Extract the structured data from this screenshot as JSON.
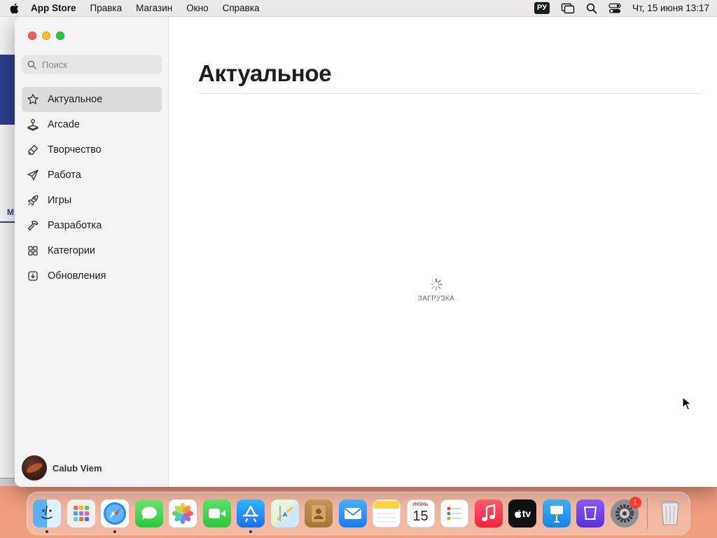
{
  "menubar": {
    "app_name": "App Store",
    "menus": [
      "Правка",
      "Магазин",
      "Окно",
      "Справка"
    ],
    "input_language": "РУ",
    "clock": "Чт, 15 июня  13:17"
  },
  "background_window": {
    "letter": "М"
  },
  "sidebar": {
    "search_placeholder": "Поиск",
    "items": [
      {
        "label": "Актуальное",
        "icon": "star-icon",
        "active": true
      },
      {
        "label": "Arcade",
        "icon": "joystick-icon",
        "active": false
      },
      {
        "label": "Творчество",
        "icon": "brush-icon",
        "active": false
      },
      {
        "label": "Работа",
        "icon": "paper-plane-icon",
        "active": false
      },
      {
        "label": "Игры",
        "icon": "rocket-icon",
        "active": false
      },
      {
        "label": "Разработка",
        "icon": "hammer-icon",
        "active": false
      },
      {
        "label": "Категории",
        "icon": "grid-icon",
        "active": false
      },
      {
        "label": "Обновления",
        "icon": "download-icon",
        "active": false
      }
    ],
    "account_name": "Calub Viem"
  },
  "main": {
    "title": "Актуальное",
    "loading_label": "ЗАГРУЗКА"
  },
  "dock": {
    "calendar_month": "ИЮНЬ",
    "calendar_day": "15",
    "tv_label": "tv",
    "settings_badge": "1"
  },
  "colors": {
    "accent": "#007aff",
    "close": "#ff5f57",
    "minimize": "#febc2e",
    "zoom": "#28c840"
  }
}
